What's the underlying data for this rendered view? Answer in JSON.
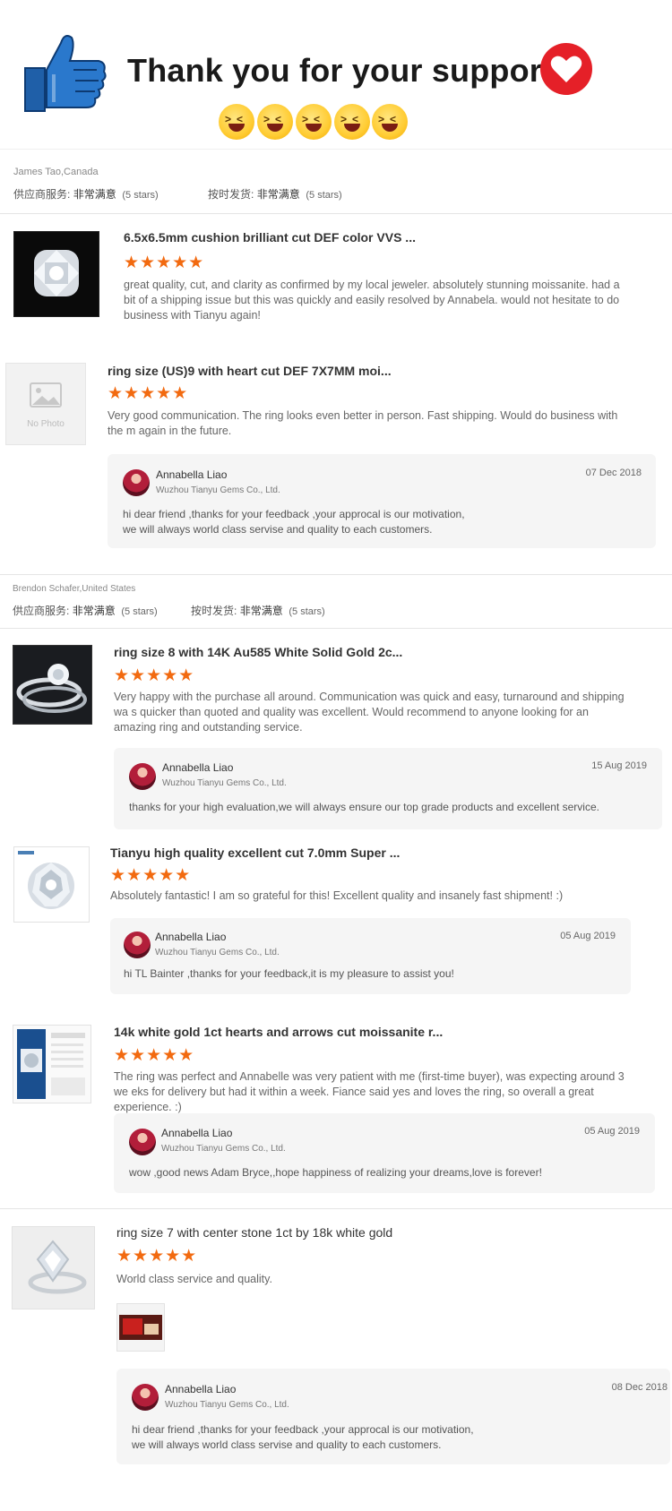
{
  "header": {
    "title": "Thank you for your support."
  },
  "reviews": [
    {
      "buyer": "James Tao,Canada",
      "ratings": [
        {
          "label": "供应商服务:",
          "value": "非常满意",
          "stars_text": "(5 stars)"
        },
        {
          "label": "按时发货:",
          "value": "非常满意",
          "stars_text": "(5 stars)"
        }
      ],
      "items": [
        {
          "title": "6.5x6.5mm cushion brilliant cut DEF color VVS ...",
          "stars": "★★★★★",
          "text": "great quality, cut, and clarity as confirmed by my local jeweler. absolutely stunning moissanite. had a bit of a shipping issue but this was quickly and easily resolved by Annabela. would not hesitate to do business with Tianyu again!"
        },
        {
          "title": "ring size (US)9 with heart cut DEF 7X7MM moi...",
          "no_photo": "No Photo",
          "stars": "★★★★★",
          "text": "Very good communication. The ring looks even better in person. Fast shipping. Would do business with the m again in the future.",
          "reply": {
            "name": "Annabella Liao",
            "company": "Wuzhou Tianyu Gems Co., Ltd.",
            "date": "07 Dec 2018",
            "text": "hi dear friend ,thanks for your feedback ,your approcal is our motivation, we will always world class servise and quality to each customers."
          }
        }
      ]
    },
    {
      "buyer": "Brendon Schafer,United States",
      "ratings": [
        {
          "label": "供应商服务:",
          "value": "非常满意",
          "stars_text": "(5 stars)"
        },
        {
          "label": "按时发货:",
          "value": "非常满意",
          "stars_text": "(5 stars)"
        }
      ],
      "items": [
        {
          "title": "ring size 8 with 14K Au585 White Solid Gold 2c...",
          "stars": "★★★★★",
          "text": "Very happy with the purchase all around. Communication was quick and easy, turnaround and shipping wa s quicker than quoted and quality was excellent. Would recommend to anyone looking for an amazing ring and outstanding service.",
          "reply": {
            "name": "Annabella Liao",
            "company": "Wuzhou Tianyu Gems Co., Ltd.",
            "date": "15 Aug 2019",
            "text": "thanks for your high evaluation,we will always ensure our top grade products and excellent service."
          }
        },
        {
          "title": "Tianyu high quality excellent cut 7.0mm Super ...",
          "stars": "★★★★★",
          "text": "Absolutely fantastic! I am so grateful for this! Excellent quality and insanely fast shipment! :)",
          "reply": {
            "name": "Annabella Liao",
            "company": "Wuzhou Tianyu Gems Co., Ltd.",
            "date": "05 Aug 2019",
            "text": "hi TL Bainter ,thanks for your feedback,it is my pleasure to assist you!"
          }
        },
        {
          "title": "14k white gold 1ct hearts and arrows cut moissanite r...",
          "stars": "★★★★★",
          "text": "The ring was perfect and Annabelle was very patient with me (first-time buyer), was expecting around 3 we eks for delivery but had it within a week. Fiance said yes and loves the ring, so overall a great experience. :)",
          "reply": {
            "name": "Annabella Liao",
            "company": "Wuzhou Tianyu Gems Co., Ltd.",
            "date": "05 Aug 2019",
            "text": "wow ,good news Adam Bryce,,hope happiness of realizing your dreams,love is forever!"
          }
        },
        {
          "title": "ring size 7 with center stone 1ct by 18k white gold",
          "stars": "★★★★★",
          "text": "World class service and quality.",
          "reply": {
            "name": "Annabella Liao",
            "company": "Wuzhou Tianyu Gems Co., Ltd.",
            "date": "08 Dec 2018",
            "text": "hi dear friend ,thanks for your feedback ,your approcal is our motivation, we will always world class servise and quality to each customers."
          }
        }
      ]
    }
  ]
}
